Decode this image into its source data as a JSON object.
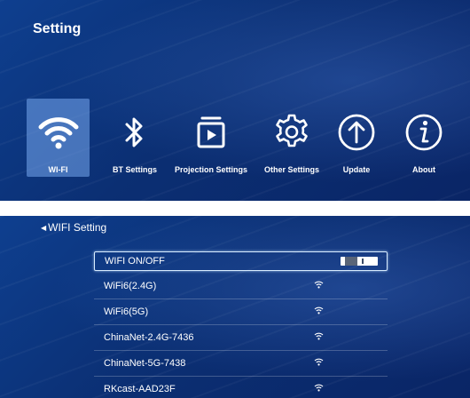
{
  "settings": {
    "title": "Setting",
    "menu": [
      {
        "label": "WI-FI",
        "icon": "wifi-icon",
        "selected": true
      },
      {
        "label": "BT Settings",
        "icon": "bluetooth-icon",
        "selected": false
      },
      {
        "label": "Projection Settings",
        "icon": "projection-icon",
        "selected": false
      },
      {
        "label": "Other Settings",
        "icon": "gear-icon",
        "selected": false
      },
      {
        "label": "Update",
        "icon": "update-arrow-icon",
        "selected": false
      },
      {
        "label": "About",
        "icon": "info-icon",
        "selected": false
      }
    ]
  },
  "wifi": {
    "back_label": "WIFI Setting",
    "toggle_label": "WIFI ON/OFF",
    "toggle_on": true,
    "networks": [
      {
        "name": "WiFi6(2.4G)",
        "icon": "wifi-signal-icon"
      },
      {
        "name": "WiFi6(5G)",
        "icon": "wifi-signal-icon"
      },
      {
        "name": "ChinaNet-2.4G-7436",
        "icon": "wifi-signal-icon"
      },
      {
        "name": "ChinaNet-5G-7438",
        "icon": "wifi-signal-icon"
      },
      {
        "name": "RKcast-AAD23F",
        "icon": "wifi-signal-icon"
      }
    ]
  },
  "colors": {
    "panel_bg": "#0b2f73",
    "selected_tile": "#7aaaf0",
    "text": "#ffffff"
  }
}
